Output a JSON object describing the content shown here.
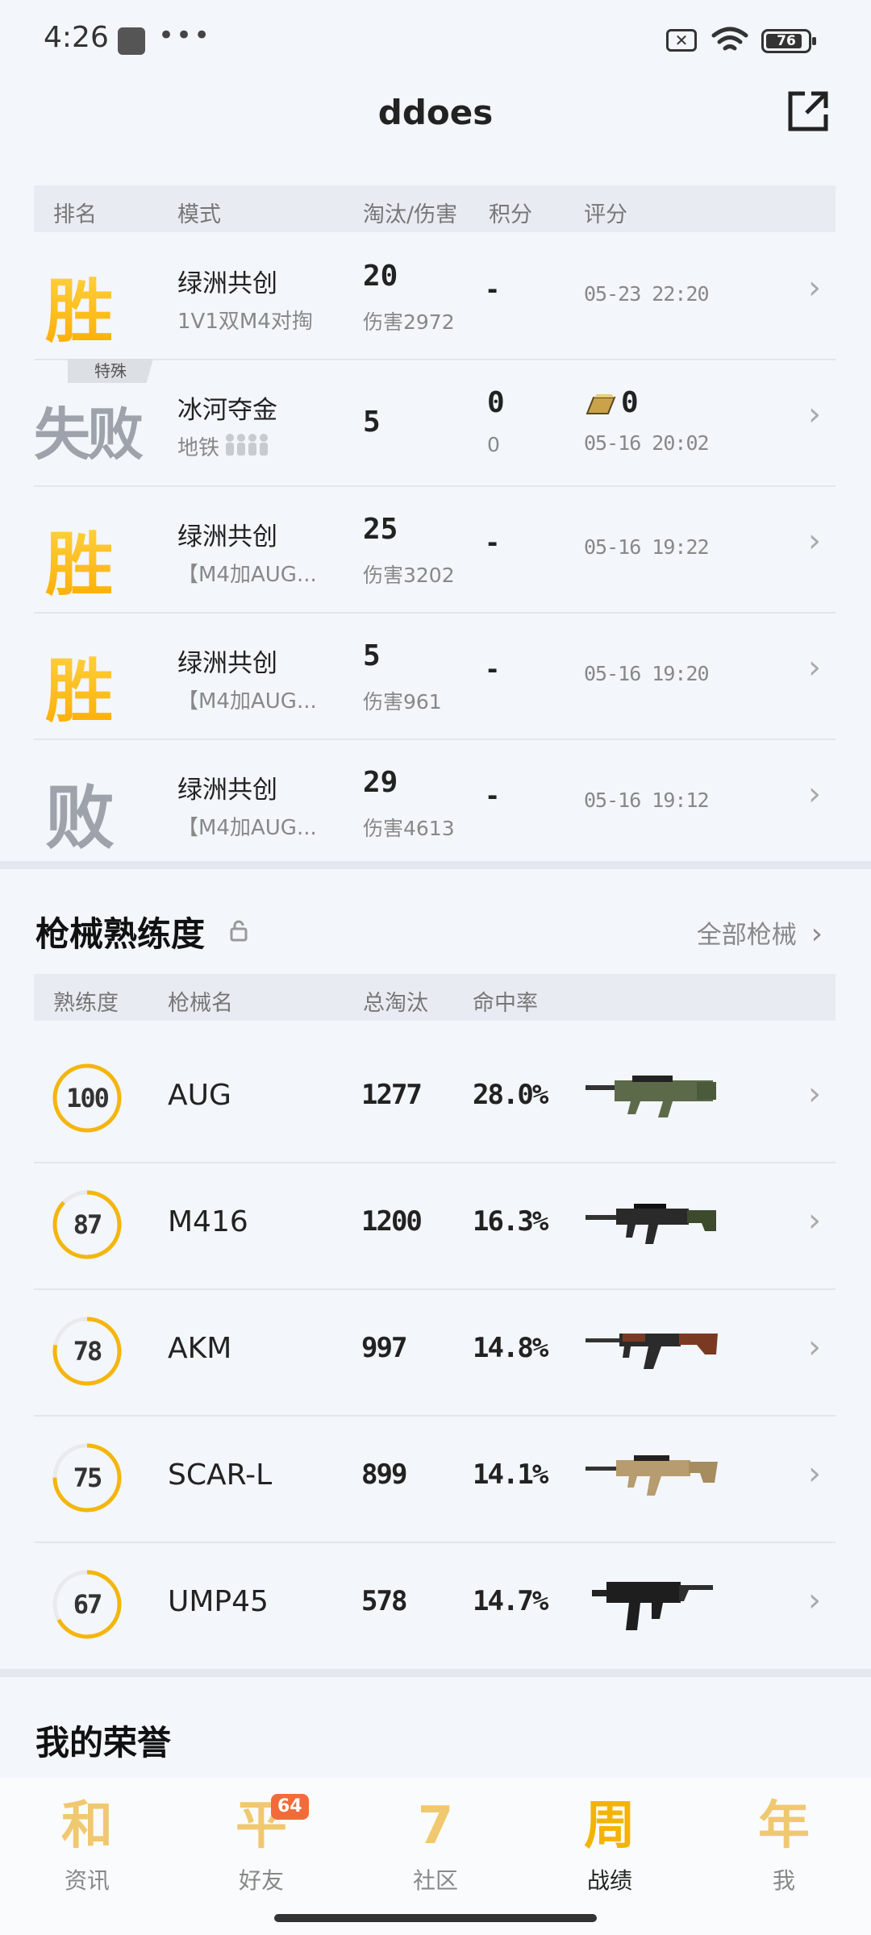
{
  "status_bar": {
    "time": "4:26",
    "battery": "76"
  },
  "header": {
    "title": "ddoes"
  },
  "matches": {
    "columns": [
      "排名",
      "模式",
      "淘汰/伤害",
      "积分",
      "评分"
    ],
    "rows": [
      {
        "result": "胜",
        "mode": "绿洲共创",
        "sub": "1V1双M4对掏",
        "kills": "20",
        "damage": "伤害2972",
        "points": "-",
        "date": "05-23 22:20"
      },
      {
        "tag": "特殊",
        "result": "失败",
        "mode": "冰河夺金",
        "sub": "地铁",
        "kills": "5",
        "points": "0",
        "points_sub": "0",
        "score": "0",
        "date": "05-16 20:02"
      },
      {
        "result": "胜",
        "mode": "绿洲共创",
        "sub": "【M4加AUG...",
        "kills": "25",
        "damage": "伤害3202",
        "points": "-",
        "date": "05-16 19:22"
      },
      {
        "result": "胜",
        "mode": "绿洲共创",
        "sub": "【M4加AUG...",
        "kills": "5",
        "damage": "伤害961",
        "points": "-",
        "date": "05-16 19:20"
      },
      {
        "result": "败",
        "mode": "绿洲共创",
        "sub": "【M4加AUG...",
        "kills": "29",
        "damage": "伤害4613",
        "points": "-",
        "date": "05-16 19:12"
      }
    ]
  },
  "weapons": {
    "title": "枪械熟练度",
    "all_link": "全部枪械",
    "columns": [
      "熟练度",
      "枪械名",
      "总淘汰",
      "命中率"
    ],
    "rows": [
      {
        "proficiency": "100",
        "name": "AUG",
        "kills": "1277",
        "accuracy": "28.0%"
      },
      {
        "proficiency": "87",
        "name": "M416",
        "kills": "1200",
        "accuracy": "16.3%"
      },
      {
        "proficiency": "78",
        "name": "AKM",
        "kills": "997",
        "accuracy": "14.8%"
      },
      {
        "proficiency": "75",
        "name": "SCAR-L",
        "kills": "899",
        "accuracy": "14.1%"
      },
      {
        "proficiency": "67",
        "name": "UMP45",
        "kills": "578",
        "accuracy": "14.7%"
      }
    ]
  },
  "honor": {
    "title": "我的荣誉"
  },
  "nav": {
    "items": [
      {
        "glyph": "和",
        "label": "资讯"
      },
      {
        "glyph": "平",
        "label": "好友",
        "badge": "64"
      },
      {
        "glyph": "7",
        "label": "社区"
      },
      {
        "glyph": "周",
        "label": "战绩"
      },
      {
        "glyph": "年",
        "label": "我"
      }
    ]
  }
}
